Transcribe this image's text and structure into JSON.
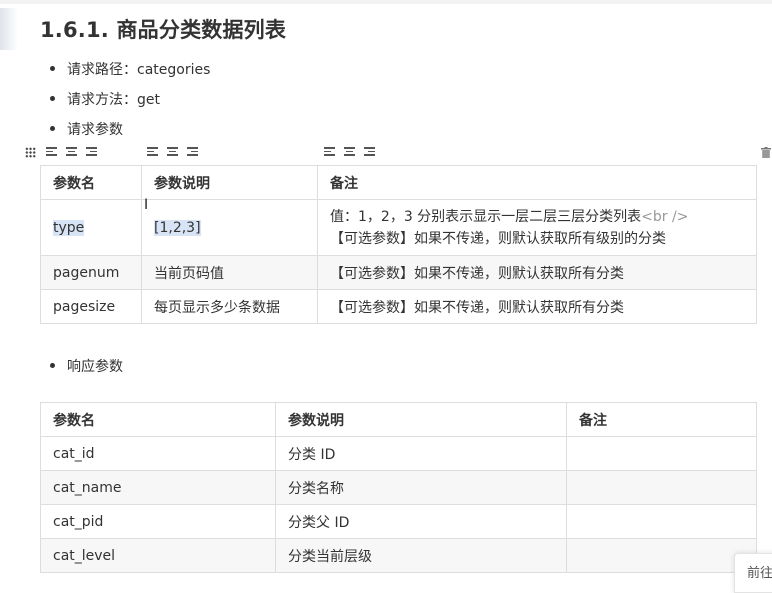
{
  "section": {
    "title": "1.6.1. 商品分类数据列表"
  },
  "bullets": {
    "path": "请求路径：categories",
    "method": "请求方法：get",
    "params_label": "请求参数",
    "response_label": "响应参数"
  },
  "request_table": {
    "headers": [
      "参数名",
      "参数说明",
      "备注"
    ],
    "rows": [
      {
        "name": "type",
        "desc": "[1,2,3]",
        "note_line1": "值：1，2，3 分别表示显示一层二层三层分类列表",
        "note_tag": "<br />",
        "note_line2": "【可选参数】如果不传递，则默认获取所有级别的分类"
      },
      {
        "name": "pagenum",
        "desc": "当前页码值",
        "note": "【可选参数】如果不传递，则默认获取所有分类"
      },
      {
        "name": "pagesize",
        "desc": "每页显示多少条数据",
        "note": "【可选参数】如果不传递，则默认获取所有分类"
      }
    ]
  },
  "response_table": {
    "headers": [
      "参数名",
      "参数说明",
      "备注"
    ],
    "rows": [
      {
        "name": "cat_id",
        "desc": "分类 ID",
        "note": ""
      },
      {
        "name": "cat_name",
        "desc": "分类名称",
        "note": ""
      },
      {
        "name": "cat_pid",
        "desc": "分类父 ID",
        "note": ""
      },
      {
        "name": "cat_level",
        "desc": "分类当前层级",
        "note": ""
      }
    ]
  },
  "corner_widget": {
    "label": "前往"
  },
  "icons": {
    "toolbar": [
      "table-grid-icon",
      "align-left-icon",
      "align-center-icon",
      "align-right-icon",
      "delete-table-icon"
    ],
    "cursor": "text-cursor-icon"
  },
  "colors": {
    "selection": "#d7e4f5",
    "border": "#dddddd",
    "row_alt": "#f7f7f7",
    "hint_text": "#999999"
  }
}
